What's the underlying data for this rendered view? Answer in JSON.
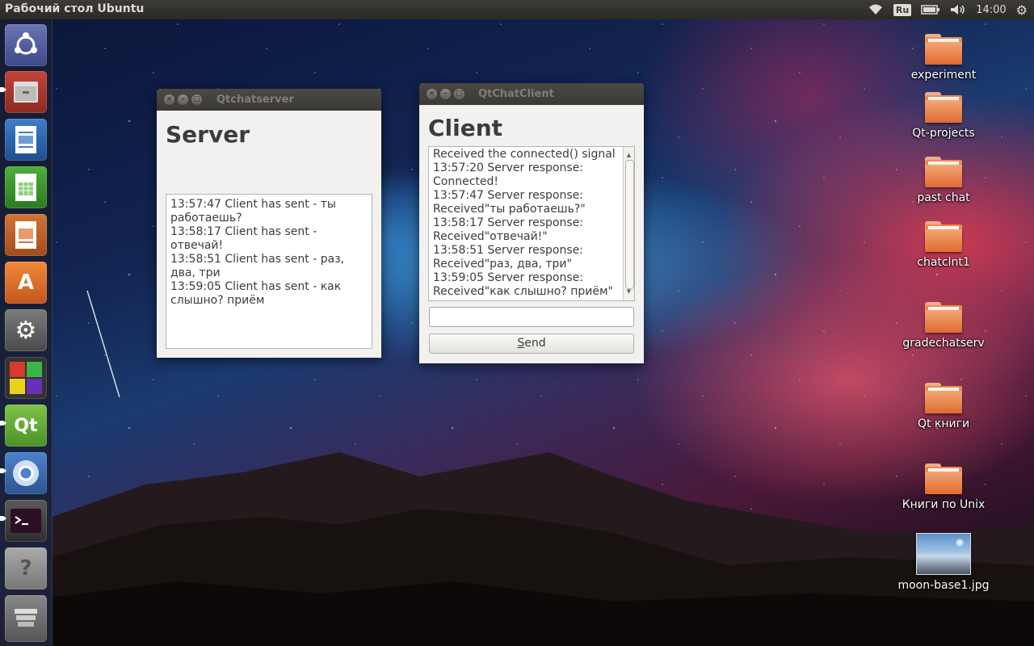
{
  "top_panel": {
    "title": "Рабочий стол Ubuntu",
    "keyboard_layout": "Ru",
    "clock": "14:00",
    "icons": [
      "wifi-icon",
      "keyboard-layout-indicator",
      "battery-icon",
      "volume-icon",
      "power-gear-icon"
    ]
  },
  "launcher": {
    "items": [
      "ubuntu-dash-icon",
      "files-icon",
      "libreoffice-writer-icon",
      "libreoffice-calc-icon",
      "libreoffice-impress-icon",
      "software-center-icon",
      "system-settings-icon",
      "workspace-switcher-icon",
      "qt-creator-icon",
      "chromium-icon",
      "terminal-icon",
      "unknown-app-icon",
      "trash-icon"
    ]
  },
  "server_window": {
    "title": "Qtchatserver",
    "heading": "Server",
    "log": [
      "13:57:47 Client has sent - ты работаешь?",
      "13:58:17 Client has sent - отвечай!",
      "13:58:51 Client has sent - раз, два, три",
      "13:59:05 Client has sent - как слышно? приём"
    ]
  },
  "client_window": {
    "title": "QtChatClient",
    "heading": "Client",
    "log": [
      "Received the connected() signal",
      "13:57:20 Server response: Connected!",
      "13:57:47 Server response: Received\"ты работаешь?\"",
      "13:58:17 Server response: Received\"отвечай!\"",
      "13:58:51 Server response: Received\"раз, два, три\"",
      "13:59:05 Server response: Received\"как слышно? приём\""
    ],
    "input_value": "",
    "send_label_accel": "S",
    "send_label_rest": "end"
  },
  "desktop": {
    "items": [
      {
        "label": "experiment",
        "type": "folder"
      },
      {
        "label": "Qt-projects",
        "type": "folder"
      },
      {
        "label": "past chat",
        "type": "folder"
      },
      {
        "label": "chatclnt1",
        "type": "folder"
      },
      {
        "label": "gradechatserv",
        "type": "folder"
      },
      {
        "label": "Qt книги",
        "type": "folder"
      },
      {
        "label": "Книги по Unix",
        "type": "folder"
      },
      {
        "label": "moon-base1.jpg",
        "type": "image"
      }
    ]
  },
  "colors": {
    "panel": "#3c3b37",
    "window_bg": "#f2f1f0",
    "folder_orange": "#e06a30"
  }
}
